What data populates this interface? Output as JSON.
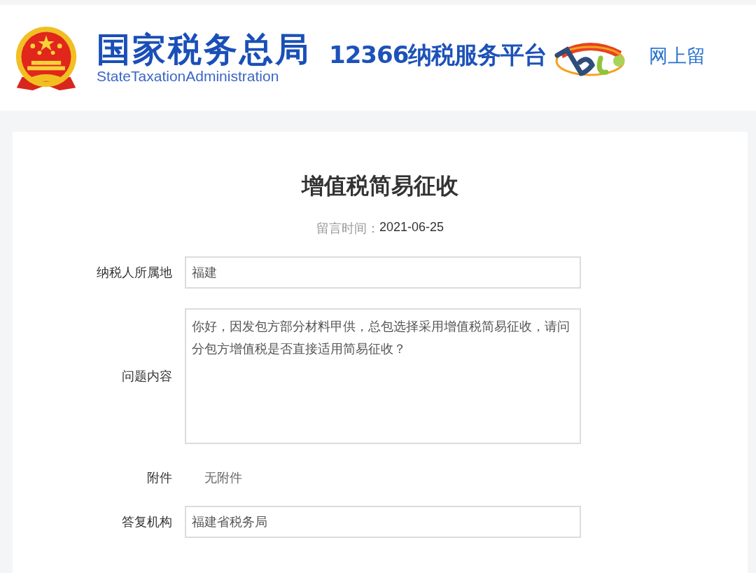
{
  "header": {
    "title": "国家税务总局",
    "subtitle": "StateTaxationAdministration",
    "platform": "12366纳税服务平台",
    "nav_link": "网上留"
  },
  "message": {
    "title": "增值税简易征收",
    "date_label": "留言时间：",
    "date": "2021-06-25",
    "fields": [
      {
        "kind": "input",
        "label": "纳税人所属地",
        "value": "福建"
      },
      {
        "kind": "textarea",
        "label": "问题内容",
        "value": "你好，因发包方部分材料甲供，总包选择采用增值税简易征收，请问分包方增值税是否直接适用简易征收？"
      },
      {
        "kind": "text",
        "label": "附件",
        "value": "无附件"
      },
      {
        "kind": "input",
        "label": "答复机构",
        "value": "福建省税务局"
      }
    ]
  }
}
